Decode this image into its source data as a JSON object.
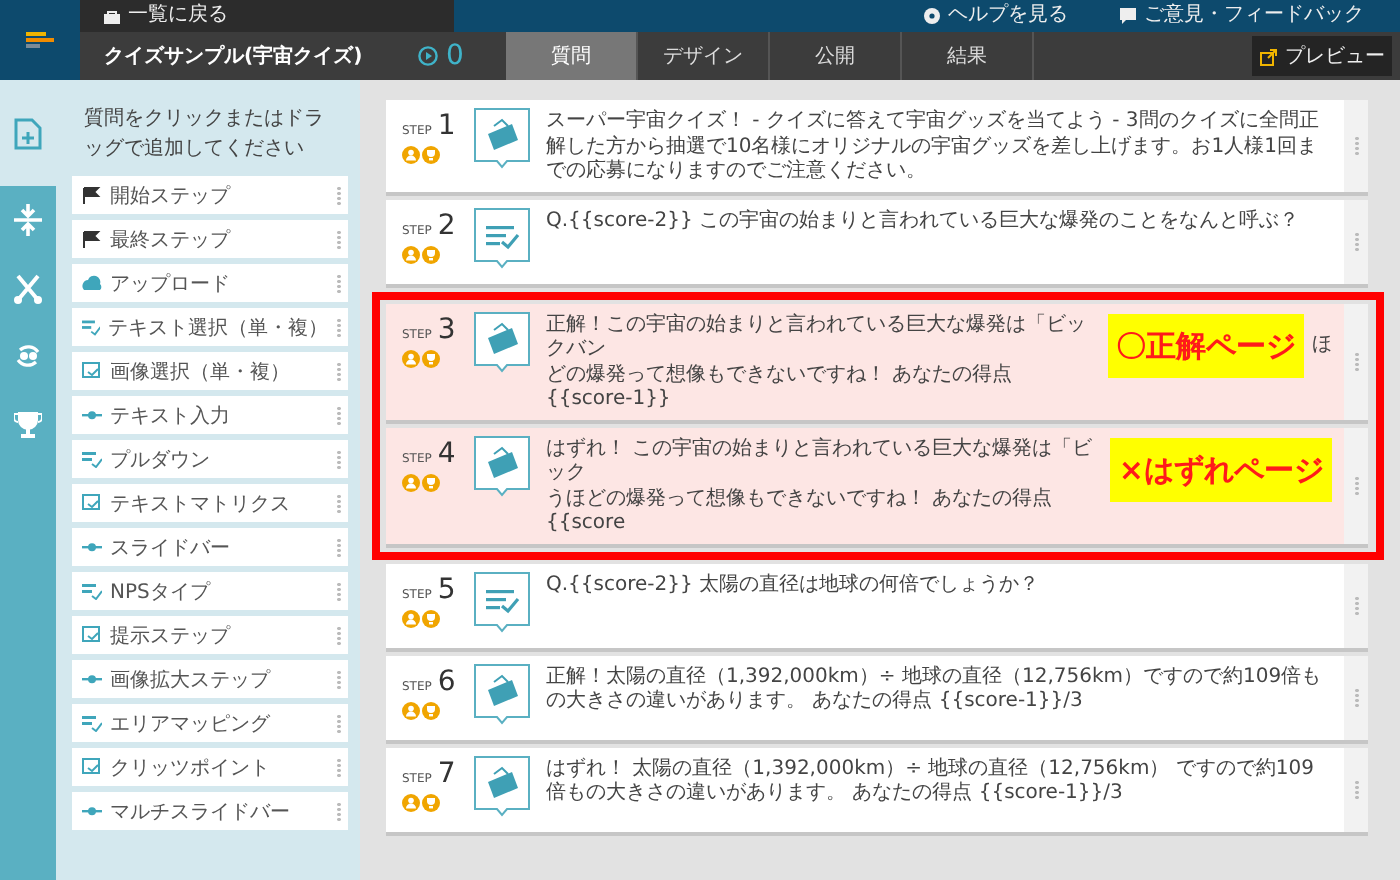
{
  "header": {
    "back_link": "一覧に戻る",
    "help_link": "ヘルプを見る",
    "feedback_link": "ご意見・フィードバック",
    "title": "クイズサンプル(宇宙クイズ)",
    "play_count": "0",
    "tabs": [
      {
        "label": "質問",
        "selected": true
      },
      {
        "label": "デザイン",
        "selected": false
      },
      {
        "label": "公開",
        "selected": false
      },
      {
        "label": "結果",
        "selected": false
      }
    ],
    "preview_button": "プレビュー"
  },
  "rail": [
    {
      "selected": true
    },
    {
      "selected": false
    },
    {
      "selected": false
    },
    {
      "selected": false
    },
    {
      "selected": false
    }
  ],
  "palette": {
    "instruction": "質問をクリックまたはドラッグで追加してください",
    "items": [
      {
        "label": "開始ステップ"
      },
      {
        "label": "最終ステップ"
      },
      {
        "label": "アップロード"
      },
      {
        "label": "テキスト選択（単・複）"
      },
      {
        "label": "画像選択（単・複）"
      },
      {
        "label": "テキスト入力"
      },
      {
        "label": "プルダウン"
      },
      {
        "label": "テキストマトリクス"
      },
      {
        "label": "スライドバー"
      },
      {
        "label": "NPSタイプ"
      },
      {
        "label": "提示ステップ"
      },
      {
        "label": "画像拡大ステップ"
      },
      {
        "label": "エリアマッピング"
      },
      {
        "label": "クリッツポイント"
      },
      {
        "label": "マルチスライドバー"
      }
    ]
  },
  "steps": [
    {
      "step_label": "STEP",
      "number": "1",
      "kind": "message",
      "highlighted": false,
      "text": "スーパー宇宙クイズ！ - クイズに答えて宇宙グッズを当てよう - 3問のクイズに全問正解した方から抽選で10名様にオリジナルの宇宙グッズを差し上げます。お1人様1回までの応募になりますのでご注意ください。"
    },
    {
      "step_label": "STEP",
      "number": "2",
      "kind": "question",
      "highlighted": false,
      "text": "Q.{{score-2}} この宇宙の始まりと言われている巨大な爆発のことをなんと呼ぶ？"
    },
    {
      "step_label": "STEP",
      "number": "3",
      "kind": "message",
      "highlighted": true,
      "lines": [
        "正解！この宇宙の始まりと言われている巨大な爆発は「ビックバン",
        "どの爆発って想像もできないですね！ あなたの得点 {{score-1}}"
      ],
      "annotation": "〇正解ページ",
      "text_after": "ほ"
    },
    {
      "step_label": "STEP",
      "number": "4",
      "kind": "message",
      "highlighted": true,
      "lines": [
        "はずれ！ この宇宙の始まりと言われている巨大な爆発は「ビック",
        "うほどの爆発って想像もできないですね！ あなたの得点 {{score"
      ],
      "annotation": "×はずれページ"
    },
    {
      "step_label": "STEP",
      "number": "5",
      "kind": "question",
      "highlighted": false,
      "text": "Q.{{score-2}} 太陽の直径は地球の何倍でしょうか？"
    },
    {
      "step_label": "STEP",
      "number": "6",
      "kind": "message",
      "highlighted": false,
      "text": "正解！太陽の直径（1,392,000km）÷ 地球の直径（12,756km）ですので約109倍もの大きさの違いがあります。 あなたの得点 {{score-1}}/3"
    },
    {
      "step_label": "STEP",
      "number": "7",
      "kind": "message",
      "highlighted": false,
      "text": "はずれ！ 太陽の直径（1,392,000km）÷ 地球の直径（12,756km） ですので約109倍もの大きさの違いがあります。 あなたの得点 {{score-1}}/3"
    }
  ]
}
